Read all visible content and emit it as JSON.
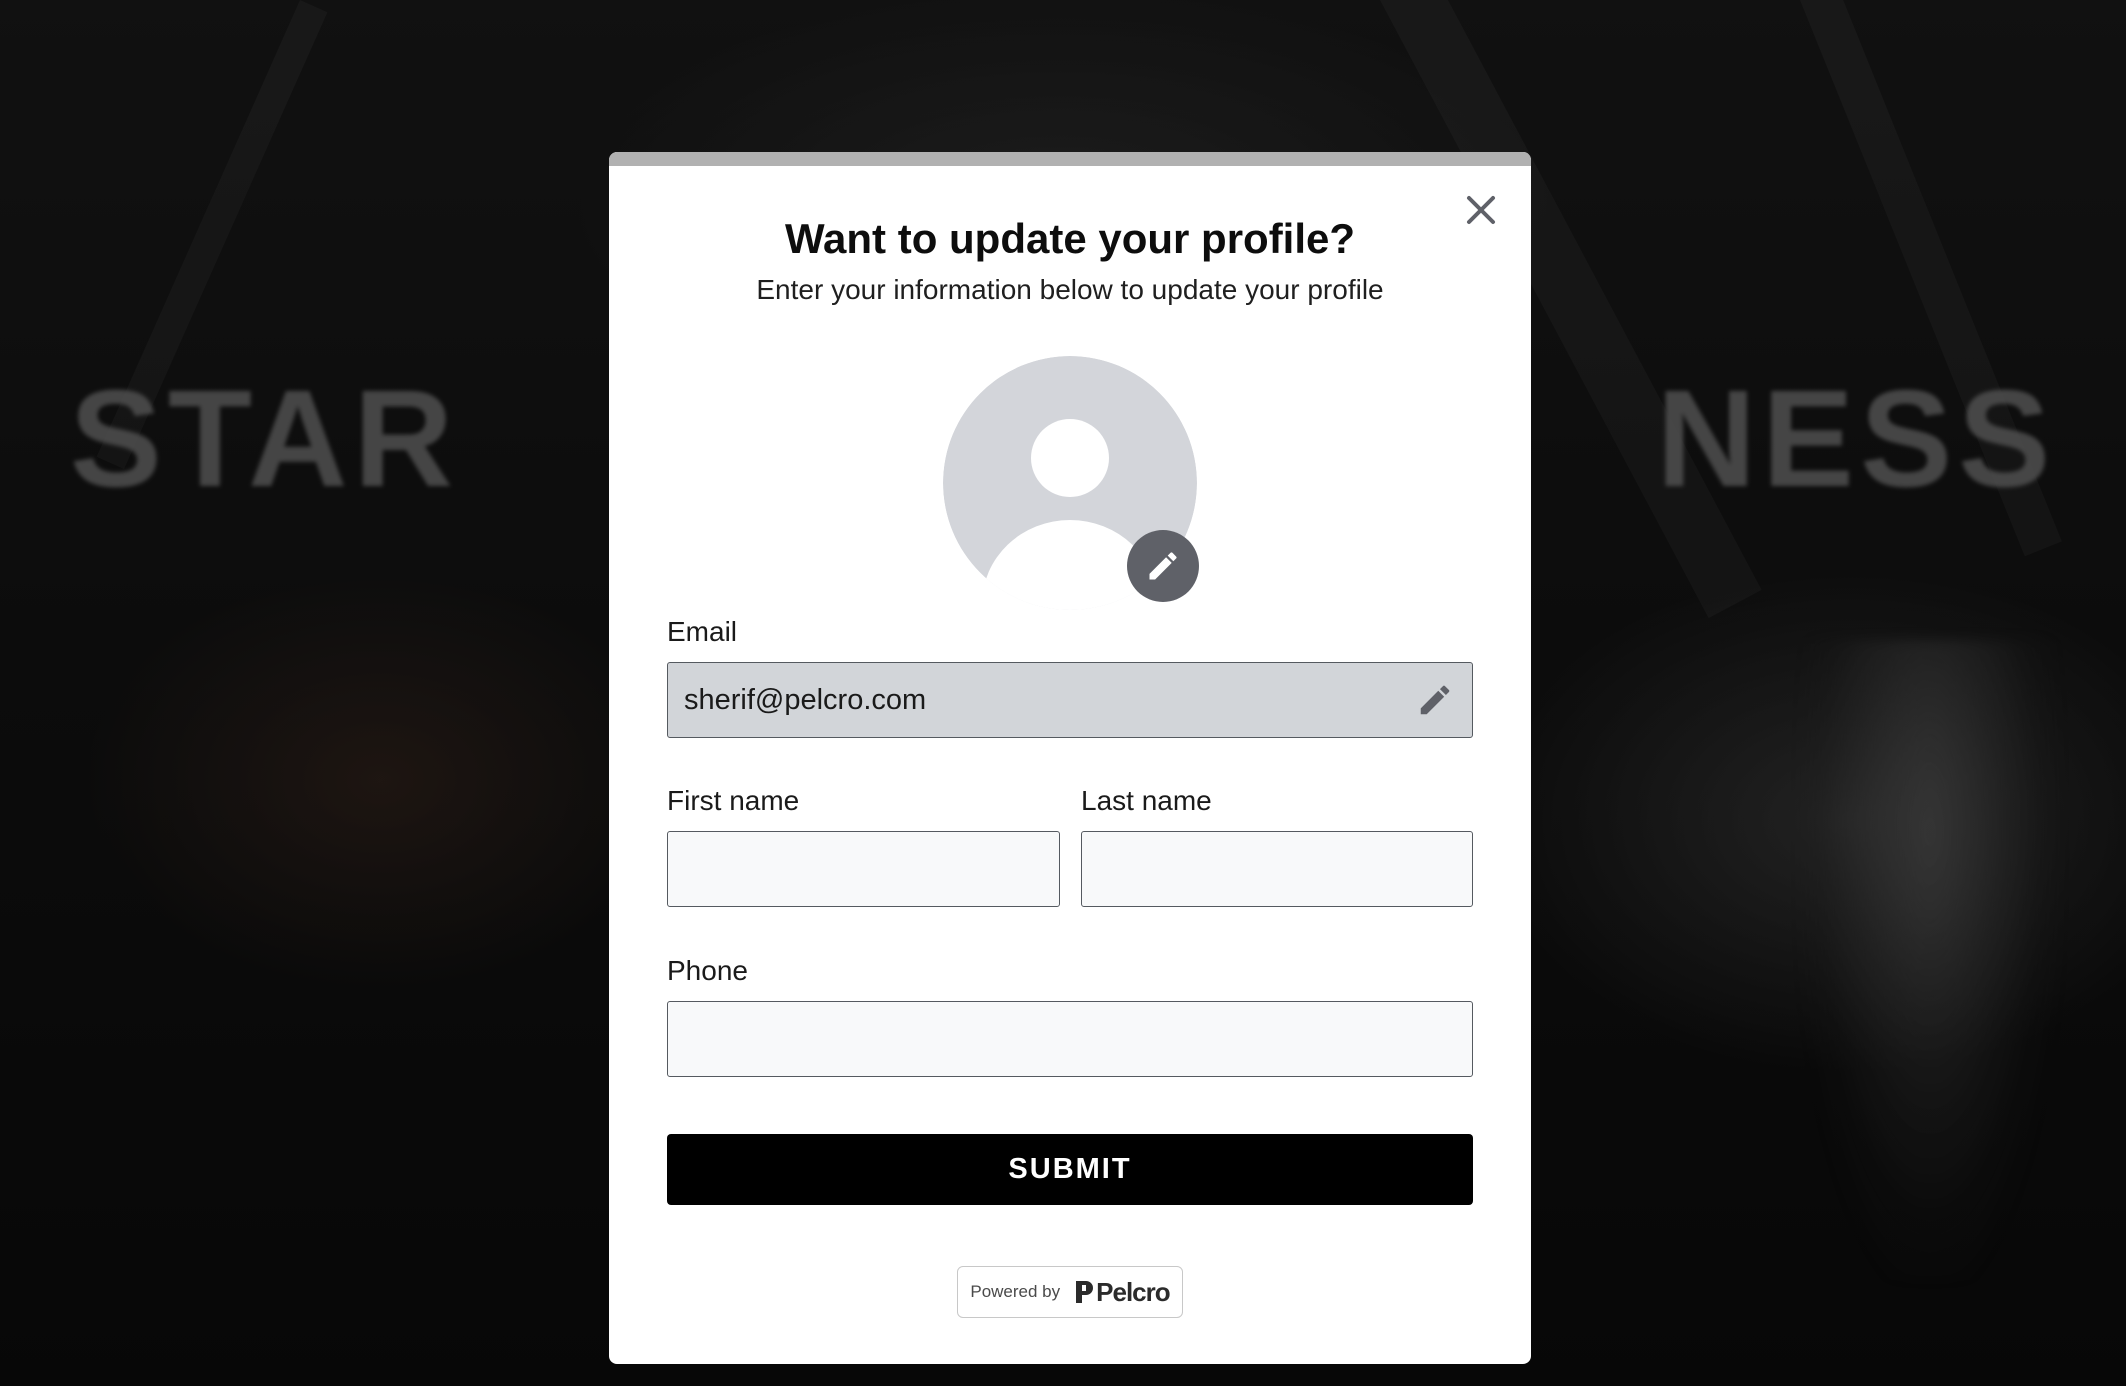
{
  "background": {
    "headline": "STAR                           NESS"
  },
  "modal": {
    "title": "Want to update your profile?",
    "subtitle": "Enter your information below to update your profile",
    "close_icon": "close-icon",
    "avatar_icon": "user-avatar-placeholder-icon",
    "avatar_edit_icon": "pencil-icon"
  },
  "form": {
    "email": {
      "label": "Email",
      "value": "sherif@pelcro.com",
      "edit_icon": "pencil-icon"
    },
    "first_name": {
      "label": "First name",
      "value": ""
    },
    "last_name": {
      "label": "Last name",
      "value": ""
    },
    "phone": {
      "label": "Phone",
      "value": ""
    },
    "submit_label": "SUBMIT"
  },
  "footer": {
    "powered_by": "Powered by",
    "brand": "Pelcro"
  },
  "colors": {
    "modal_topbar": "#b1b1b1",
    "submit_bg": "#000000",
    "email_field_bg": "#d2d5d9",
    "avatar_bg": "#d3d5da",
    "avatar_edit_bg": "#5f6168"
  }
}
